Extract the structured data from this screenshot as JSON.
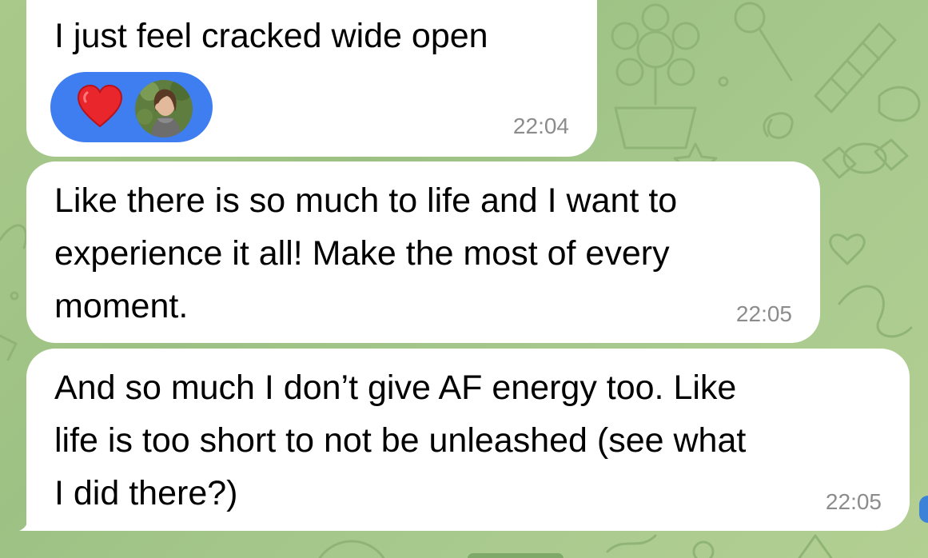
{
  "chat": {
    "messages": [
      {
        "lines": [
          "I just feel cracked wide open"
        ],
        "time": "22:04",
        "reaction": {
          "emoji_icon": "red-heart-icon",
          "color": "#3f7ef0"
        }
      },
      {
        "lines": [
          "Like there is so much to life and I want to",
          "experience it all! Make the most of every",
          "moment."
        ],
        "time": "22:05"
      },
      {
        "lines": [
          "And so much I don’t give AF energy too. Like",
          "life is too short to not be unleashed (see what",
          "I did there?)"
        ],
        "time": "22:05"
      }
    ]
  },
  "colors": {
    "bubble": "#ffffff",
    "timestamp": "#8c8c8c",
    "reaction_pill": "#3f7ef0",
    "background": "#a9c98a"
  }
}
